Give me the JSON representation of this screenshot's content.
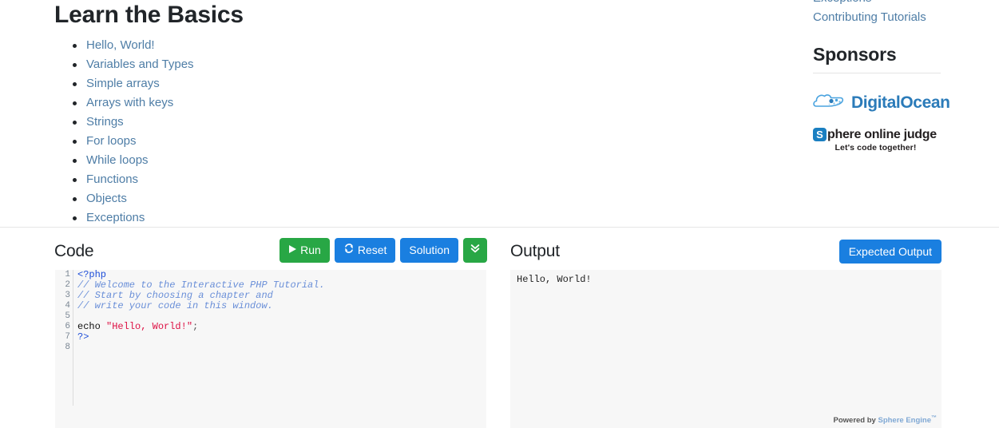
{
  "page": {
    "title": "Learn the Basics"
  },
  "basics": {
    "items": [
      {
        "label": "Hello, World!"
      },
      {
        "label": "Variables and Types"
      },
      {
        "label": "Simple arrays"
      },
      {
        "label": "Arrays with keys"
      },
      {
        "label": "Strings"
      },
      {
        "label": "For loops"
      },
      {
        "label": "While loops"
      },
      {
        "label": "Functions"
      },
      {
        "label": "Objects"
      },
      {
        "label": "Exceptions"
      }
    ]
  },
  "right_rail": {
    "links": [
      {
        "label": "Exceptions"
      },
      {
        "label": "Contributing Tutorials"
      }
    ],
    "sponsors_heading": "Sponsors",
    "sponsors": [
      {
        "name": "digitalocean",
        "icon": "cloud-icon",
        "wordmark": "DigitalOcean",
        "color": "#2b7bb9"
      },
      {
        "name": "sphere-online-judge",
        "badge": "S",
        "wordmark": "phere online judge",
        "tagline": "Let's code together!",
        "color": "#1a7fc1"
      }
    ]
  },
  "code_panel": {
    "title": "Code",
    "buttons": [
      {
        "label": "Run",
        "icon": "play-icon",
        "color": "#28a745"
      },
      {
        "label": "Reset",
        "icon": "refresh-icon",
        "color": "#1a7fe0"
      },
      {
        "label": "Solution",
        "icon": "",
        "color": "#1a7fe0"
      },
      {
        "label": "",
        "icon": "chevron-double-down-icon",
        "color": "#28a745"
      }
    ],
    "line_numbers": [
      "1",
      "2",
      "3",
      "4",
      "5",
      "6",
      "7",
      "8"
    ],
    "lines": [
      "<?php",
      "// Welcome to the Interactive PHP Tutorial.",
      "// Start by choosing a chapter and",
      "// write your code in this window.",
      "",
      "echo \"Hello, World!\";",
      "?>",
      ""
    ]
  },
  "output_panel": {
    "title": "Output",
    "expected_output_label": "Expected Output",
    "text": "Hello, World!",
    "powered_by_prefix": "Powered by",
    "powered_by_link": "Sphere Engine",
    "powered_by_tm": "™"
  }
}
